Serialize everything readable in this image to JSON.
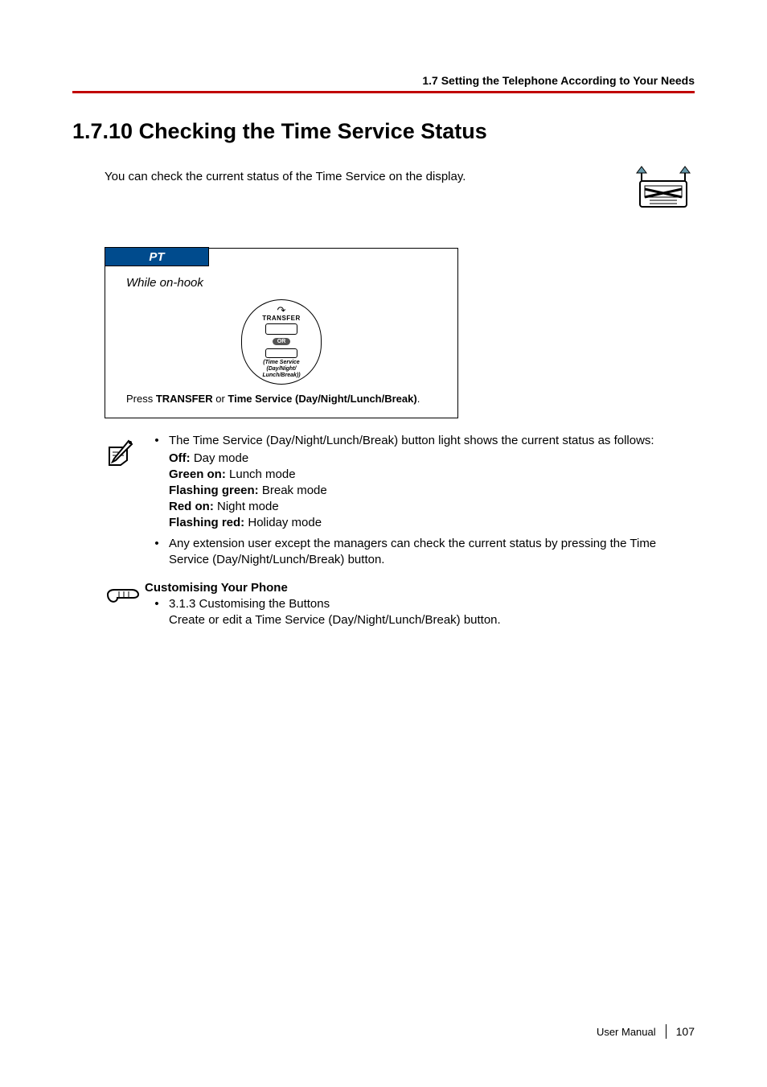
{
  "header": {
    "breadcrumb": "1.7 Setting the Telephone According to Your Needs"
  },
  "section": {
    "title": "1.7.10   Checking the Time Service Status",
    "intro": "You can check the current status of the Time Service on the display."
  },
  "pt_box": {
    "tab": "PT",
    "subtitle": "While on-hook",
    "transfer_label": "TRANSFER",
    "or_label": "OR",
    "ts_line1": "(Time Service",
    "ts_line2": "(Day/Night/",
    "ts_line3": "Lunch/Break))",
    "press_prefix": "Press ",
    "press_bold1": "TRANSFER",
    "press_mid": " or ",
    "press_bold2": "Time Service (Day/Night/Lunch/Break)",
    "press_suffix": "."
  },
  "notes": {
    "bullet1": "The Time Service (Day/Night/Lunch/Break) button light shows the current status as follows:",
    "off_label": "Off:",
    "off_text": " Day mode",
    "green_label": "Green on:",
    "green_text": " Lunch mode",
    "flashg_label": "Flashing green:",
    "flashg_text": " Break mode",
    "red_label": "Red on:",
    "red_text": " Night mode",
    "flashr_label": "Flashing red:",
    "flashr_text": " Holiday mode",
    "bullet2": "Any extension user except the managers can check the current status by pressing the Time Service (Day/Night/Lunch/Break) button."
  },
  "custom": {
    "heading": "Customising Your Phone",
    "bullet": "3.1.3 Customising the Buttons",
    "subline": "Create or edit a Time Service (Day/Night/Lunch/Break) button."
  },
  "footer": {
    "label": "User Manual",
    "page": "107"
  }
}
